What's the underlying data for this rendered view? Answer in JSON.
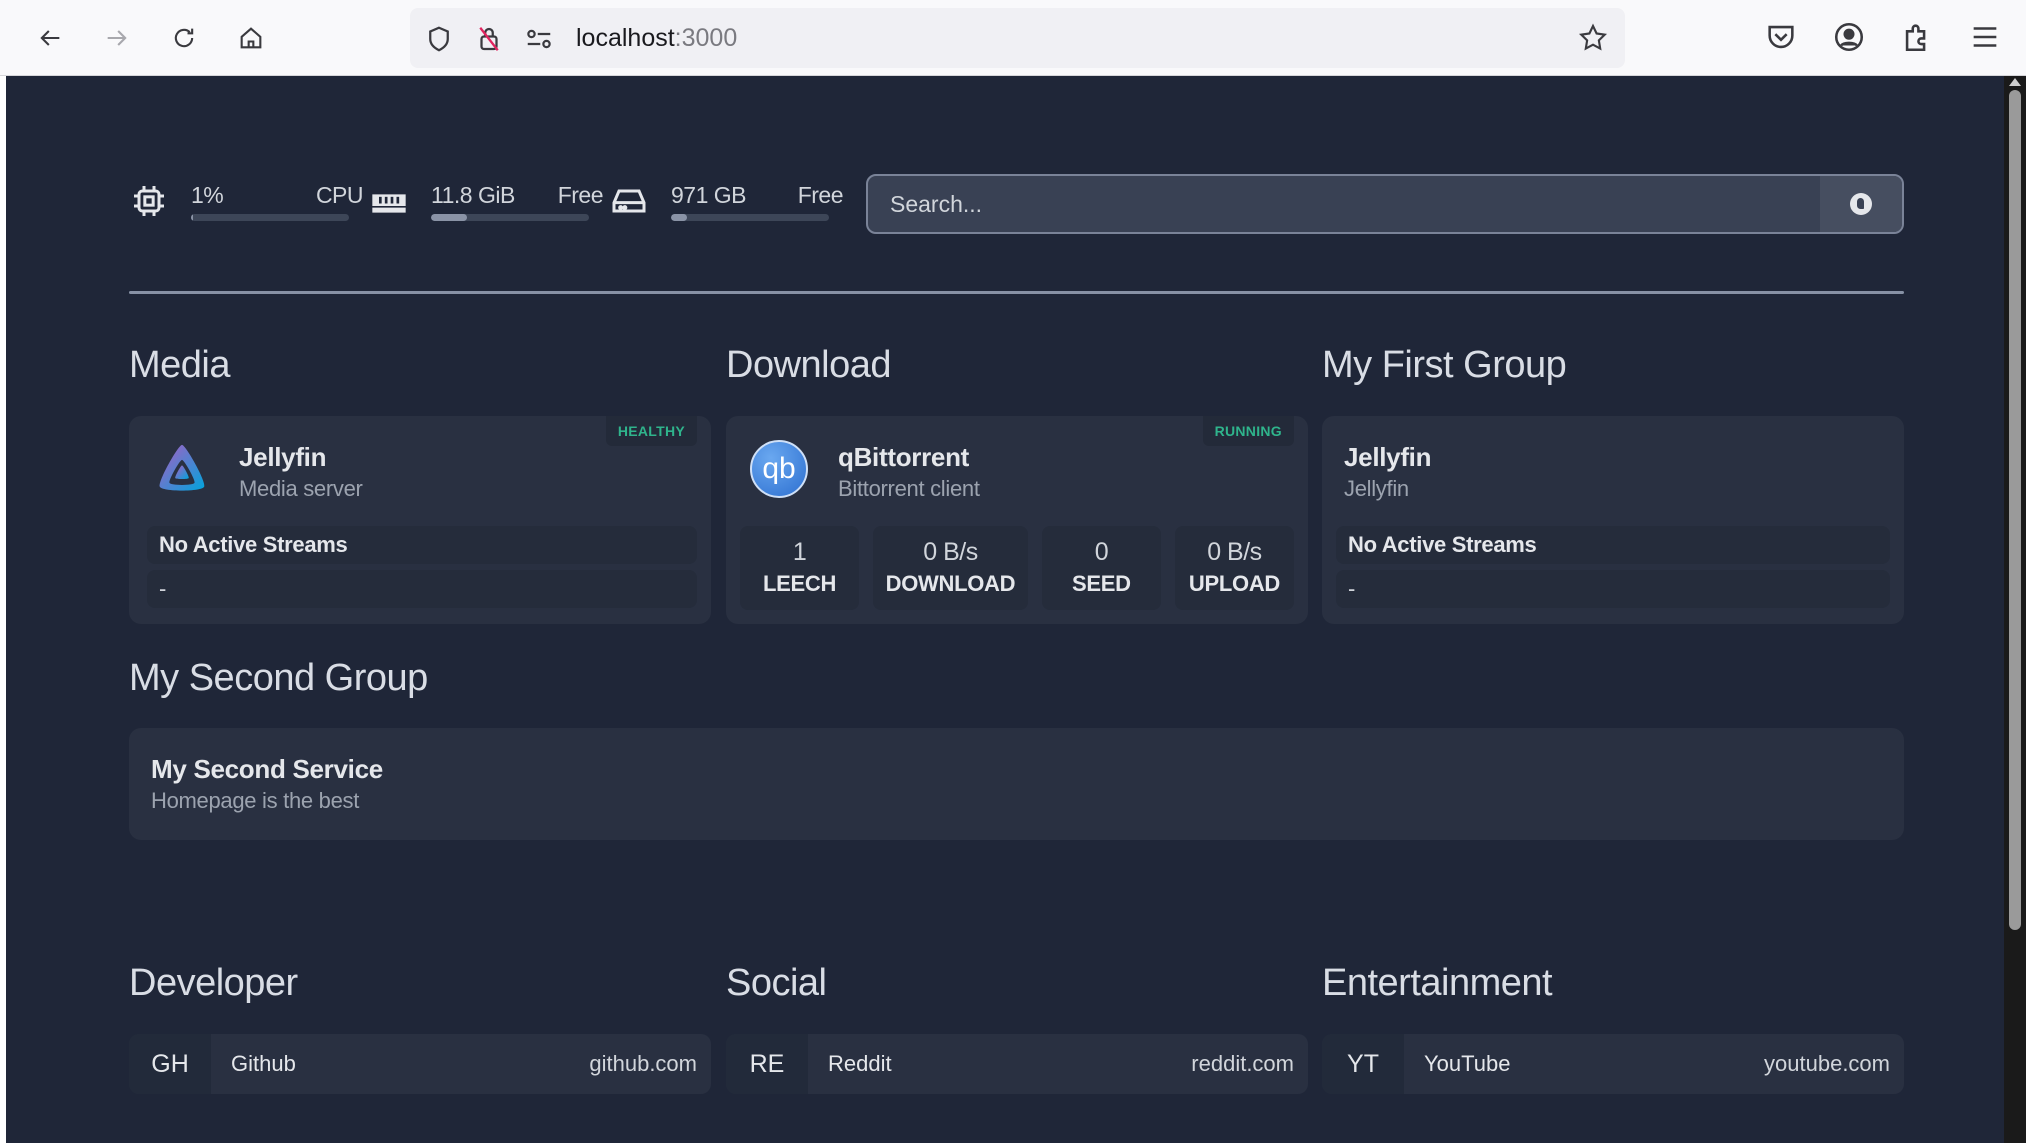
{
  "browser": {
    "url_host": "localhost",
    "url_port": ":3000"
  },
  "resources": {
    "cpu": {
      "value": "1%",
      "label": "CPU",
      "usage_percent": 1
    },
    "memory": {
      "value": "11.8 GiB",
      "label": "Free",
      "usage_percent": 23
    },
    "disk": {
      "value": "971 GB",
      "label": "Free",
      "usage_percent": 10
    }
  },
  "search": {
    "placeholder": "Search..."
  },
  "groups": {
    "media": {
      "title": "Media",
      "service": {
        "name": "Jellyfin",
        "description": "Media server",
        "status": "HEALTHY",
        "streams_label": "No Active Streams",
        "streams_detail": "-"
      }
    },
    "download": {
      "title": "Download",
      "service": {
        "name": "qBittorrent",
        "description": "Bittorrent client",
        "status": "RUNNING",
        "icon_text": "qb",
        "stats": [
          {
            "value": "1",
            "label": "LEECH"
          },
          {
            "value": "0 B/s",
            "label": "DOWNLOAD"
          },
          {
            "value": "0",
            "label": "SEED"
          },
          {
            "value": "0 B/s",
            "label": "UPLOAD"
          }
        ]
      }
    },
    "first": {
      "title": "My First Group",
      "service": {
        "name": "Jellyfin",
        "description": "Jellyfin",
        "streams_label": "No Active Streams",
        "streams_detail": "-"
      }
    },
    "second": {
      "title": "My Second Group",
      "service": {
        "name": "My Second Service",
        "description": "Homepage is the best"
      }
    }
  },
  "bookmarks": [
    {
      "group": "Developer",
      "abbr": "GH",
      "name": "Github",
      "url": "github.com"
    },
    {
      "group": "Social",
      "abbr": "RE",
      "name": "Reddit",
      "url": "reddit.com"
    },
    {
      "group": "Entertainment",
      "abbr": "YT",
      "name": "YouTube",
      "url": "youtube.com"
    }
  ],
  "colors": {
    "background": "#1f2638",
    "card": "#293041",
    "status_green": "#2fb48c"
  }
}
